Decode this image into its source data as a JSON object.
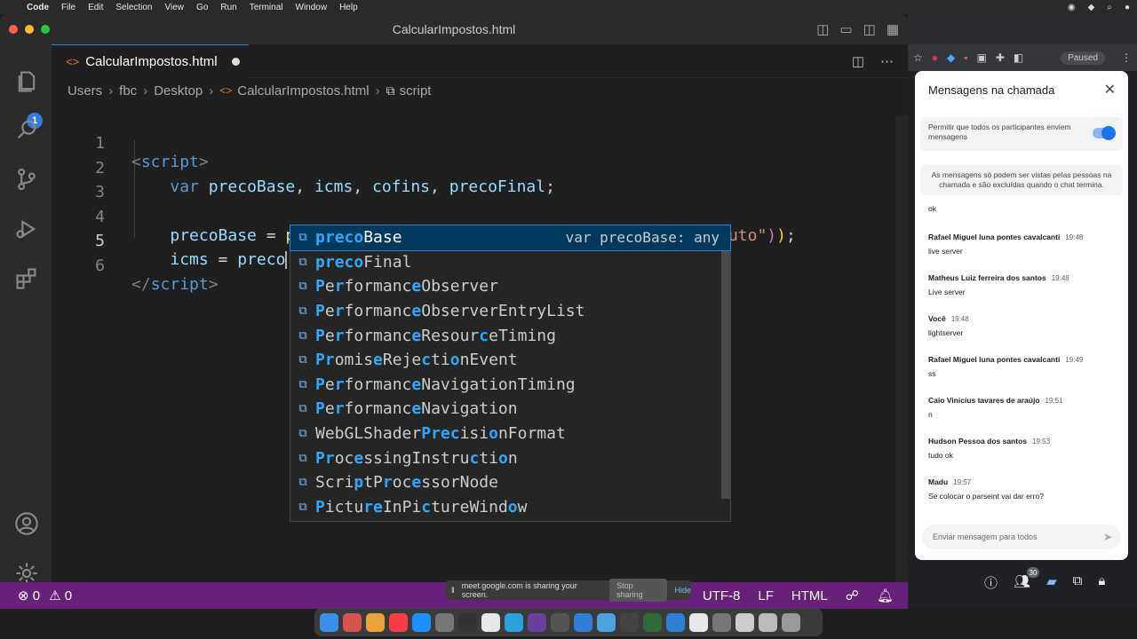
{
  "menubar": {
    "app": "Code",
    "items": [
      "File",
      "Edit",
      "Selection",
      "View",
      "Go",
      "Run",
      "Terminal",
      "Window",
      "Help"
    ]
  },
  "window": {
    "title": "CalcularImpostos.html"
  },
  "activity": {
    "badge": "1"
  },
  "tab": {
    "label": "CalcularImpostos.html",
    "icon": "<>"
  },
  "breadcrumb": {
    "parts": [
      "Users",
      "fbc",
      "Desktop",
      "CalcularImpostos.html",
      "script"
    ]
  },
  "code": {
    "line_numbers": [
      "1",
      "2",
      "3",
      "4",
      "5",
      "6"
    ],
    "active_line": "5"
  },
  "suggest": {
    "typed": "preco",
    "items": [
      {
        "label": "precoBase",
        "detail": "var precoBase: any"
      },
      {
        "label": "precoFinal",
        "detail": ""
      },
      {
        "label": "PerformanceObserver",
        "detail": ""
      },
      {
        "label": "PerformanceObserverEntryList",
        "detail": ""
      },
      {
        "label": "PerformanceResourceTiming",
        "detail": ""
      },
      {
        "label": "PromiseRejectionEvent",
        "detail": ""
      },
      {
        "label": "PerformanceNavigationTiming",
        "detail": ""
      },
      {
        "label": "PerformanceNavigation",
        "detail": ""
      },
      {
        "label": "WebGLShaderPrecisionFormat",
        "detail": ""
      },
      {
        "label": "ProcessingInstruction",
        "detail": ""
      },
      {
        "label": "ScriptProcessorNode",
        "detail": ""
      },
      {
        "label": "PictureInPictureWindow",
        "detail": ""
      }
    ]
  },
  "statusbar": {
    "errors": "0",
    "warnings": "0",
    "encoding": "UTF-8",
    "eol": "LF",
    "language": "HTML"
  },
  "sharebar": {
    "text": "meet.google.com is sharing your screen.",
    "stop": "Stop sharing",
    "hide": "Hide"
  },
  "chrome": {
    "paused": "Paused"
  },
  "meet": {
    "title": "Mensagens na chamada",
    "toggle_text": "Permitir que todos os participantes enviem mensagens",
    "info": "As mensagens só podem ser vistas pelas pessoas na chamada e são excluídas quando o chat termina.",
    "first_msg": "ok",
    "messages": [
      {
        "who": "Rafael Miguel luna pontes cavalcanti",
        "time": "19:48",
        "text": "live server"
      },
      {
        "who": "Matheus Luiz ferreira dos santos",
        "time": "19:48",
        "text": "Live server"
      },
      {
        "who": "Você",
        "time": "19:48",
        "text": "lightserver"
      },
      {
        "who": "Rafael Miguel luna pontes cavalcanti",
        "time": "19:49",
        "text": "ss"
      },
      {
        "who": "Caio Vinicius tavares de araújo",
        "time": "19:51",
        "text": "n"
      },
      {
        "who": "Hudson Pessoa dos santos",
        "time": "19:53",
        "text": "tudo ok"
      },
      {
        "who": "Madu",
        "time": "19:57",
        "text": "Se colocar o parseint vai dar erro?"
      }
    ],
    "input_placeholder": "Enviar mensagem para todos",
    "participants": "30"
  }
}
